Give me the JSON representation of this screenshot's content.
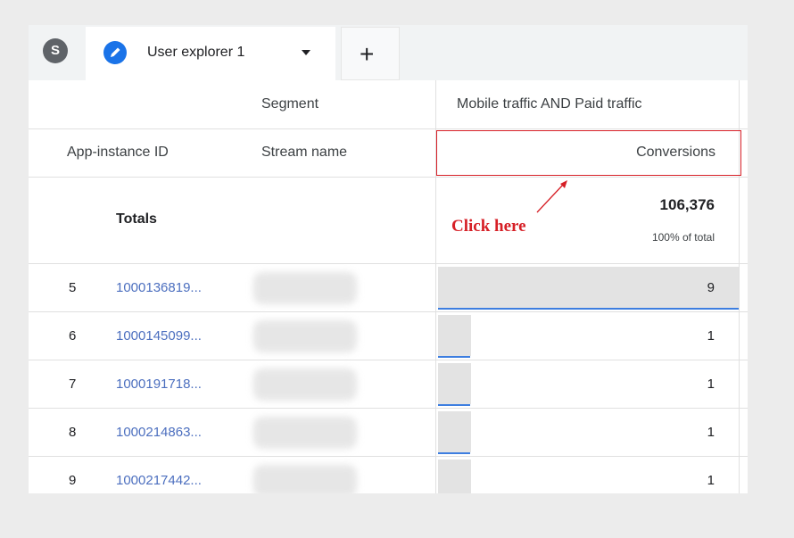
{
  "tabs": {
    "avatar_letter": "S",
    "active_label": "User explorer 1",
    "add_label": "+"
  },
  "table": {
    "segment_label": "Segment",
    "segment_value": "Mobile traffic AND Paid traffic",
    "columns": [
      "App-instance ID",
      "Stream name",
      "Conversions"
    ],
    "totals_label": "Totals",
    "totals_value": "106,376",
    "totals_sub": "100% of total",
    "rows": [
      {
        "index": "5",
        "id": "1000136819...",
        "conversions": "9",
        "fill": 1.0
      },
      {
        "index": "6",
        "id": "1000145099...",
        "conversions": "1",
        "fill": 0.11
      },
      {
        "index": "7",
        "id": "1000191718...",
        "conversions": "1",
        "fill": 0.11
      },
      {
        "index": "8",
        "id": "1000214863...",
        "conversions": "1",
        "fill": 0.11
      },
      {
        "index": "9",
        "id": "1000217442...",
        "conversions": "1",
        "fill": 0.11
      }
    ]
  },
  "annotation": {
    "text": "Click here",
    "color": "#d61f26"
  },
  "colors": {
    "link": "#4c6fbf",
    "accent": "#1a73e8",
    "bar_line": "#3d7ee0"
  }
}
